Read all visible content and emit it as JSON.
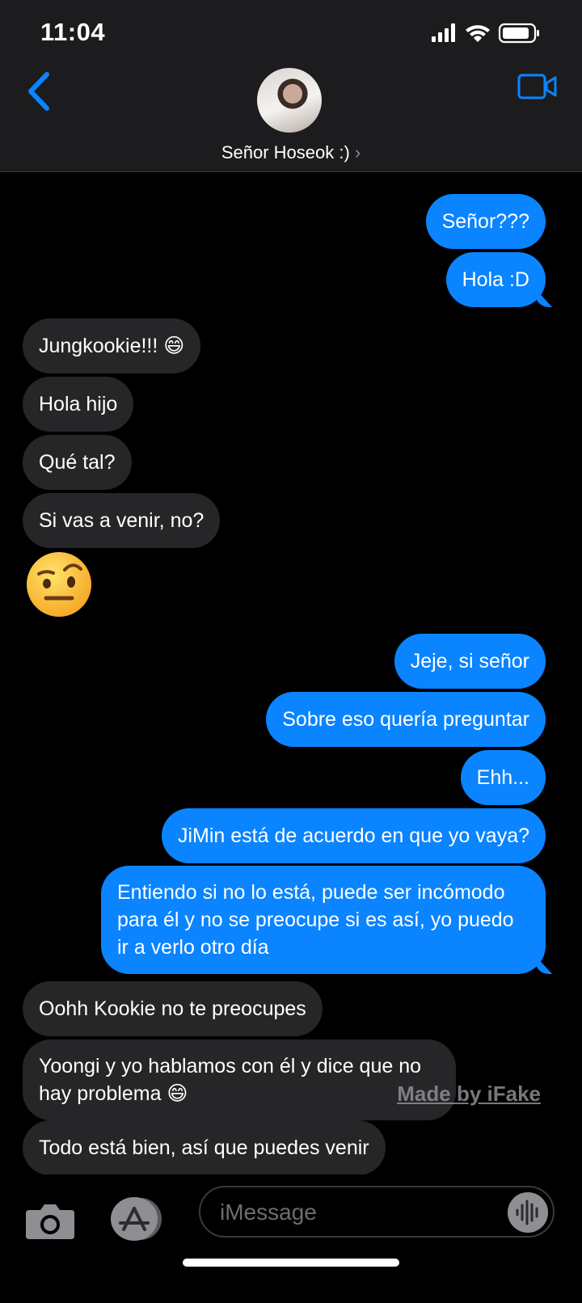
{
  "status_bar": {
    "time": "11:04"
  },
  "header": {
    "contact_name": "Señor Hoseok :)",
    "chevron": "›"
  },
  "messages": [
    {
      "dir": "out",
      "text": "Señor???"
    },
    {
      "dir": "out",
      "text": "Hola :D"
    },
    {
      "dir": "in",
      "text": "Jungkookie!!! 😄"
    },
    {
      "dir": "in",
      "text": "Hola hijo"
    },
    {
      "dir": "in",
      "text": "Qué tal?"
    },
    {
      "dir": "in",
      "text": "Si vas a venir, no?"
    },
    {
      "dir": "in",
      "emoji": "raised-eyebrow-face",
      "text": "🤨"
    },
    {
      "dir": "out",
      "text": "Jeje, si señor"
    },
    {
      "dir": "out",
      "text": "Sobre eso quería preguntar"
    },
    {
      "dir": "out",
      "text": "Ehh..."
    },
    {
      "dir": "out",
      "text": "JiMin está de acuerdo en que yo vaya?"
    },
    {
      "dir": "out",
      "text": "Entiendo si no lo está, puede ser incómodo para él y no se preocupe si es así, yo puedo ir a verlo otro día"
    },
    {
      "dir": "in",
      "text": "Oohh Kookie no te preocupes"
    },
    {
      "dir": "in",
      "text": "Yoongi y yo hablamos con él y dice que no hay problema 😄"
    },
    {
      "dir": "in",
      "text": "Todo está bien, así que puedes venir"
    }
  ],
  "watermark": "Made by iFake",
  "composer": {
    "placeholder": "iMessage"
  },
  "colors": {
    "outgoing": "#0a84ff",
    "incoming": "#262628",
    "accent": "#0a84ff"
  }
}
